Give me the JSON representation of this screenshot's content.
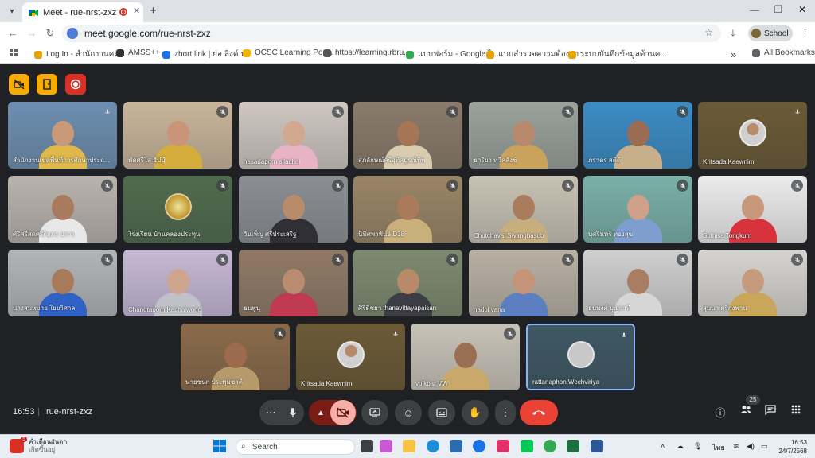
{
  "browser": {
    "tab_title": "Meet - rue-nrst-zxz",
    "url": "meet.google.com/rue-nrst-zxz",
    "profile_label": "School",
    "bookmarks": [
      {
        "label": "Log In - สำนักงานคณ...",
        "color": "#e6a300"
      },
      {
        "label": "AMSS++",
        "color": "#333333"
      },
      {
        "label": "zhort.link | ย่อ ลิงค์ ฟ...",
        "color": "#1a73e8"
      },
      {
        "label": "OCSC Learning Portal",
        "color": "#f4b400"
      },
      {
        "label": "https://learning.rbru...",
        "color": "#555555"
      },
      {
        "label": "แบบฟอร์ม - Google ไ...",
        "color": "#34a853"
      },
      {
        "label": "แบบสำรวจความต้องกา...",
        "color": "#e6a300"
      },
      {
        "label": "ระบบบันทึกข้อมูลด้านค...",
        "color": "#e6a300"
      }
    ],
    "all_bookmarks_label": "All Bookmarks"
  },
  "meeting": {
    "time": "16:53",
    "code": "rue-nrst-zxz",
    "participant_count": "25",
    "participants": [
      {
        "name": "สำนักงานเขตพื้นที่การศึกษาประถ...",
        "bg": "#6d8fb0",
        "skin": "#c99a7a",
        "shirt": "#e0b84a",
        "muted": false,
        "kind": "room"
      },
      {
        "name": "พัดศรีโส ธัปปุ๊",
        "bg": "#c9b59a",
        "skin": "#c9957a",
        "shirt": "#d4ad3a",
        "muted": true,
        "kind": "person"
      },
      {
        "name": "hasadaporn silachai",
        "bg": "#cfc7c0",
        "skin": "#d2a890",
        "shirt": "#e8b3c4",
        "muted": true,
        "kind": "person"
      },
      {
        "name": "สุภลักษณ์ศรีอุทิศบูรณ์ทิพ",
        "bg": "#8a7b6a",
        "skin": "#a57556",
        "shirt": "#d9cbb0",
        "muted": true,
        "kind": "person"
      },
      {
        "name": "ธาริยา ทวีคลังช์",
        "bg": "#9aa29c",
        "skin": "#b8896c",
        "shirt": "#c9a35b",
        "muted": true,
        "kind": "person"
      },
      {
        "name": "ภราดร สติดี",
        "bg": "#3c8cc4",
        "skin": "#9a6c52",
        "shirt": "#c7b089",
        "muted": true,
        "kind": "person"
      },
      {
        "name": "Kritsada Kaewnim",
        "bg": "#6b5a36",
        "skin": "#b68a6a",
        "shirt": "#d0d0d0",
        "muted": false,
        "kind": "avatar"
      },
      {
        "name": "ศิริศรีสดศรีกิยภร ปราร",
        "bg": "#b9b3ad",
        "skin": "#a87b5f",
        "shirt": "#e8e8e8",
        "muted": true,
        "kind": "person"
      },
      {
        "name": "โรงเรียน บ้านคลองประทุน",
        "bg": "#506b4e",
        "skin": "#c0952a",
        "shirt": "#c0952a",
        "muted": true,
        "kind": "logo"
      },
      {
        "name": "วันเพ็ญ ศรีประเสริฐ",
        "bg": "#8b8f93",
        "skin": "#b88b6b",
        "shirt": "#2f2f35",
        "muted": true,
        "kind": "person"
      },
      {
        "name": "นิพิศพาพันธ์ D38",
        "bg": "#9a8566",
        "skin": "#a97b5a",
        "shirt": "#c9b07a",
        "muted": true,
        "kind": "person"
      },
      {
        "name": "Chutchaval Swanghasub",
        "bg": "#c8c2b4",
        "skin": "#a87c5c",
        "shirt": "#c6ae7e",
        "muted": true,
        "kind": "person"
      },
      {
        "name": "บุศรินทร์ ทองสุข",
        "bg": "#7ab0a8",
        "skin": "#cfa08a",
        "shirt": "#7e9ed0",
        "muted": true,
        "kind": "person"
      },
      {
        "name": "Suthisa Tongkum",
        "bg": "#ececec",
        "skin": "#c9987c",
        "shirt": "#d8323c",
        "muted": true,
        "kind": "person"
      },
      {
        "name": "นางสมหมาย ใยยวิศาล",
        "bg": "#b2b4b8",
        "skin": "#a77a5a",
        "shirt": "#2f62c4",
        "muted": true,
        "kind": "person"
      },
      {
        "name": "Chanutaporn Kachaiwong",
        "bg": "#c6b8d6",
        "skin": "#cfa58e",
        "shirt": "#bfc1c6",
        "muted": true,
        "kind": "person"
      },
      {
        "name": "ธนพูนุ",
        "bg": "#907a66",
        "skin": "#b98c70",
        "shirt": "#c03a52",
        "muted": true,
        "kind": "person"
      },
      {
        "name": "ศิริติชยา thanavittayapaisan",
        "bg": "#7d8a70",
        "skin": "#b88a6a",
        "shirt": "#3d3d45",
        "muted": true,
        "kind": "person"
      },
      {
        "name": "nadol vana",
        "bg": "#b8b0a3",
        "skin": "#c59378",
        "shirt": "#5b7fc0",
        "muted": true,
        "kind": "person"
      },
      {
        "name": "ธนพงศ์ บุญวาที",
        "bg": "#cfcfcf",
        "skin": "#a87d62",
        "shirt": "#d6d6d6",
        "muted": true,
        "kind": "person"
      },
      {
        "name": "สุมนา ศรีกงพาน",
        "bg": "#d6d4d0",
        "skin": "#c69a7d",
        "shirt": "#c9a75a",
        "muted": true,
        "kind": "person"
      },
      {
        "name": "นายชนก ประทุมชาติ",
        "bg": "#8a6a4a",
        "skin": "#9c6a4c",
        "shirt": "#b69a6a",
        "muted": true,
        "kind": "person"
      },
      {
        "name": "Kritsada Kaewnim",
        "bg": "#6b5a36",
        "skin": "#b68a6a",
        "shirt": "#d0d0d0",
        "muted": false,
        "kind": "avatar"
      },
      {
        "name": "volkbar VW",
        "bg": "#c8c3b8",
        "skin": "#9a6f52",
        "shirt": "#c9a86c",
        "muted": true,
        "kind": "person"
      },
      {
        "name": "rattanaphon Wechviriya",
        "bg": "#3f5864",
        "skin": "#c8c8c8",
        "shirt": "#c8c8c8",
        "muted": false,
        "kind": "avatar"
      }
    ]
  },
  "taskbar": {
    "weather_line1": "คำเตือนฝนตก",
    "weather_line2": "เกิดขึ้นอยู่",
    "weather_badge": "5",
    "search_placeholder": "Search",
    "language": "ไทย",
    "clock_time": "16:53",
    "clock_date": "24/7/2568"
  }
}
